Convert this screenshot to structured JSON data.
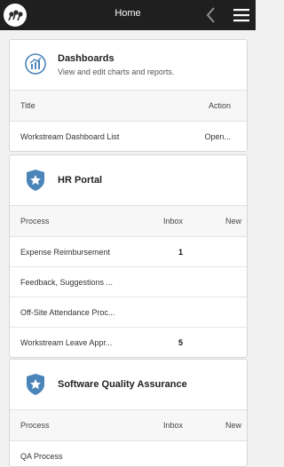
{
  "header": {
    "title": "Home"
  },
  "dashboards": {
    "title": "Dashboards",
    "subtitle": "View and edit charts and reports.",
    "columns": {
      "title": "Title",
      "action": "Action"
    },
    "rows": [
      {
        "title": "Workstream Dashboard List",
        "action": "Open..."
      }
    ]
  },
  "hr_portal": {
    "title": "HR Portal",
    "columns": {
      "process": "Process",
      "inbox": "Inbox",
      "new": "New"
    },
    "rows": [
      {
        "process": "Expense Reimbursement",
        "inbox": "1",
        "new": ""
      },
      {
        "process": "Feedback, Suggestions ...",
        "inbox": "",
        "new": ""
      },
      {
        "process": "Off-Site Attendance Proc...",
        "inbox": "",
        "new": ""
      },
      {
        "process": "Workstream Leave Appr...",
        "inbox": "5",
        "new": ""
      }
    ]
  },
  "sqa": {
    "title": "Software Quality Assurance",
    "columns": {
      "process": "Process",
      "inbox": "Inbox",
      "new": "New"
    },
    "rows": [
      {
        "process": "QA Process",
        "inbox": "",
        "new": ""
      }
    ]
  },
  "colors": {
    "topbar": "#1f1f1f",
    "icon_blue": "#4a84b8",
    "background": "#f1f1f1"
  }
}
